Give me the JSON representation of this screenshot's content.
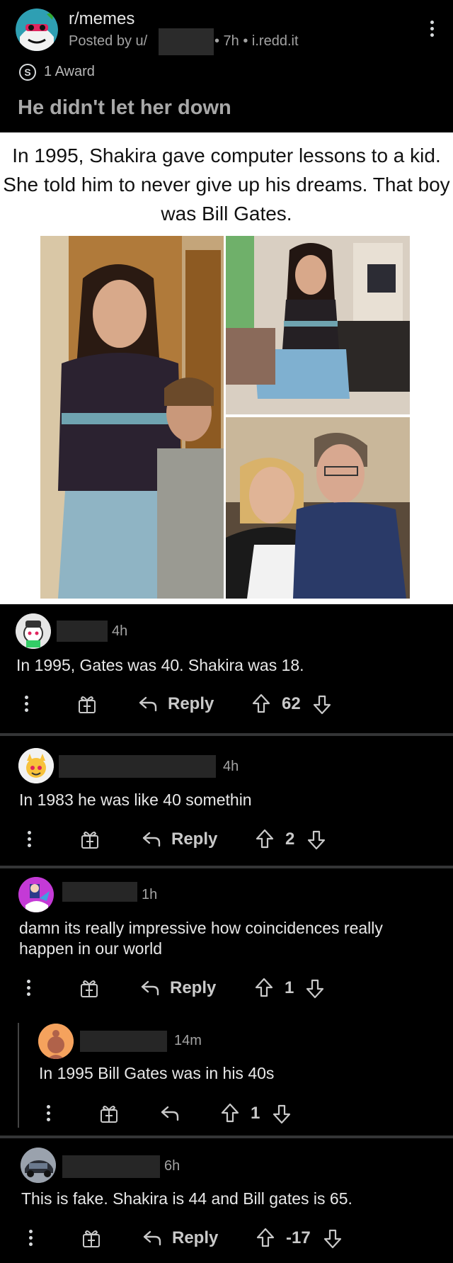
{
  "post": {
    "subreddit": "r/memes",
    "posted_by": "Posted by u/",
    "time_domain": "• 7h • i.redd.it",
    "award_count": "1 Award",
    "title": "He didn't let her down"
  },
  "meme": {
    "caption": "In 1995, Shakira gave computer lessons to a kid. She told him to never give up his dreams. That boy was Bill Gates."
  },
  "comments": [
    {
      "time": "4h",
      "text": "In 1995, Gates was 40. Shakira was 18.",
      "reply_label": "Reply",
      "score": "62"
    },
    {
      "time": "4h",
      "text": "In 1983 he was like 40 somethin",
      "reply_label": "Reply",
      "score": "2"
    },
    {
      "time": "1h",
      "text": "damn its really impressive how coincidences really happen in our world",
      "reply_label": "Reply",
      "score": "1"
    },
    {
      "time": "14m",
      "text": "In 1995 Bill Gates was in his 40s",
      "reply_label": "",
      "score": "1"
    },
    {
      "time": "6h",
      "text": "This is fake. Shakira is 44 and Bill gates is 65.",
      "reply_label": "Reply",
      "score": "-17"
    }
  ],
  "colors": {
    "background": "#000000",
    "text": "#d7dadc",
    "muted": "#a3a3a3",
    "divider": "#343536",
    "redaction": "#262626"
  },
  "icons": [
    "subreddit-avatar-icon",
    "more-options-icon",
    "award-icon",
    "give-award-icon",
    "reply-arrow-icon",
    "upvote-icon",
    "downvote-icon"
  ]
}
